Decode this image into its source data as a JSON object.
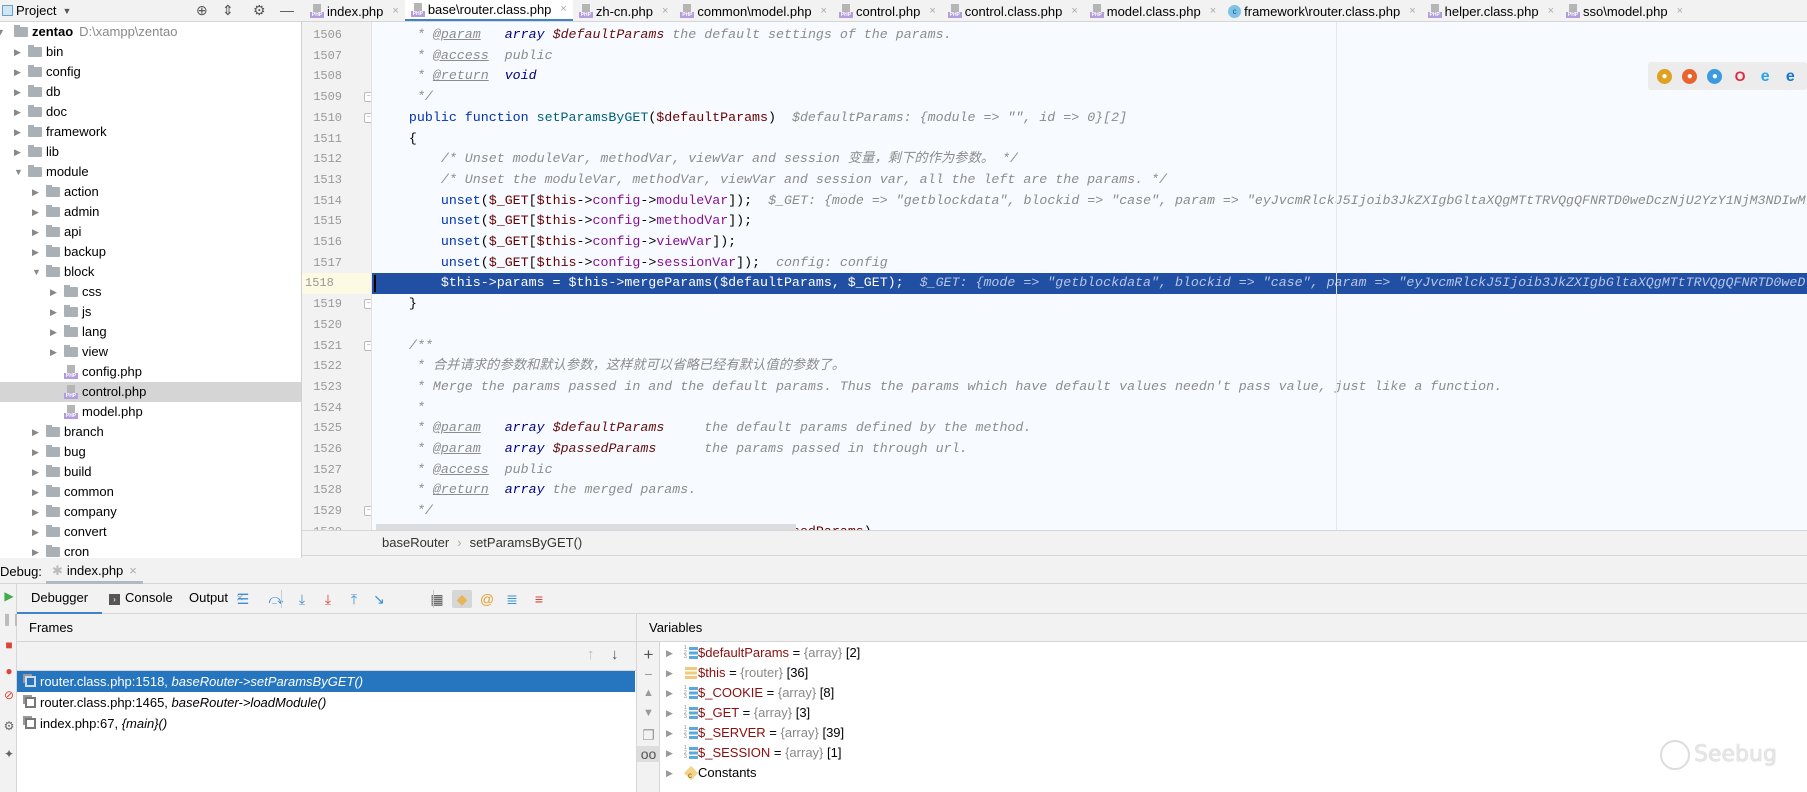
{
  "project": {
    "title": "Project",
    "toolbar_icons": [
      "locate-icon",
      "collapse-icon",
      "gear-icon",
      "minimize-icon"
    ],
    "tree": [
      {
        "label": "zentao",
        "path": "D:\\xampp\\zentao",
        "depth": 0,
        "type": "folder",
        "expanded": true,
        "root": true
      },
      {
        "label": "bin",
        "depth": 1,
        "type": "folder",
        "expanded": false
      },
      {
        "label": "config",
        "depth": 1,
        "type": "folder",
        "expanded": false
      },
      {
        "label": "db",
        "depth": 1,
        "type": "folder",
        "expanded": false
      },
      {
        "label": "doc",
        "depth": 1,
        "type": "folder",
        "expanded": false
      },
      {
        "label": "framework",
        "depth": 1,
        "type": "folder",
        "expanded": false
      },
      {
        "label": "lib",
        "depth": 1,
        "type": "folder",
        "expanded": false
      },
      {
        "label": "module",
        "depth": 1,
        "type": "folder",
        "expanded": true
      },
      {
        "label": "action",
        "depth": 2,
        "type": "folder",
        "expanded": false
      },
      {
        "label": "admin",
        "depth": 2,
        "type": "folder",
        "expanded": false
      },
      {
        "label": "api",
        "depth": 2,
        "type": "folder",
        "expanded": false
      },
      {
        "label": "backup",
        "depth": 2,
        "type": "folder",
        "expanded": false
      },
      {
        "label": "block",
        "depth": 2,
        "type": "folder",
        "expanded": true
      },
      {
        "label": "css",
        "depth": 3,
        "type": "folder",
        "expanded": false
      },
      {
        "label": "js",
        "depth": 3,
        "type": "folder",
        "expanded": false
      },
      {
        "label": "lang",
        "depth": 3,
        "type": "folder",
        "expanded": false
      },
      {
        "label": "view",
        "depth": 3,
        "type": "folder",
        "expanded": false
      },
      {
        "label": "config.php",
        "depth": 3,
        "type": "php"
      },
      {
        "label": "control.php",
        "depth": 3,
        "type": "php",
        "selected": true
      },
      {
        "label": "model.php",
        "depth": 3,
        "type": "php"
      },
      {
        "label": "branch",
        "depth": 2,
        "type": "folder",
        "expanded": false
      },
      {
        "label": "bug",
        "depth": 2,
        "type": "folder",
        "expanded": false
      },
      {
        "label": "build",
        "depth": 2,
        "type": "folder",
        "expanded": false
      },
      {
        "label": "common",
        "depth": 2,
        "type": "folder",
        "expanded": false
      },
      {
        "label": "company",
        "depth": 2,
        "type": "folder",
        "expanded": false
      },
      {
        "label": "convert",
        "depth": 2,
        "type": "folder",
        "expanded": false
      },
      {
        "label": "cron",
        "depth": 2,
        "type": "folder",
        "expanded": false
      }
    ]
  },
  "tabs": [
    {
      "label": "index.php",
      "icon": "php"
    },
    {
      "label": "base\\router.class.php",
      "icon": "php",
      "active": true
    },
    {
      "label": "zh-cn.php",
      "icon": "php"
    },
    {
      "label": "common\\model.php",
      "icon": "php"
    },
    {
      "label": "control.php",
      "icon": "php"
    },
    {
      "label": "control.class.php",
      "icon": "php"
    },
    {
      "label": "model.class.php",
      "icon": "php"
    },
    {
      "label": "framework\\router.class.php",
      "icon": "class"
    },
    {
      "label": "helper.class.php",
      "icon": "php"
    },
    {
      "label": "sso\\model.php",
      "icon": "php"
    }
  ],
  "tab_close": "×",
  "php_badge": "PHP",
  "class_badge": "c",
  "browsers": [
    {
      "name": "chrome-icon",
      "color": "#e0a020",
      "glyph": "●"
    },
    {
      "name": "firefox-icon",
      "color": "#e8642c",
      "glyph": "●"
    },
    {
      "name": "safari-icon",
      "color": "#3a9be0",
      "glyph": "●"
    },
    {
      "name": "opera-icon",
      "color": "#e0283c",
      "glyph": "O"
    },
    {
      "name": "ie-icon",
      "color": "#2aa4e6",
      "glyph": "e"
    },
    {
      "name": "edge-icon",
      "color": "#1478d4",
      "glyph": "e"
    }
  ],
  "editor": {
    "current_line": "1518",
    "lines": [
      {
        "num": "1506",
        "tokens": [
          [
            "c",
            "     * "
          ],
          [
            "tag",
            "@param"
          ],
          [
            "c",
            "   "
          ],
          [
            "type",
            "array"
          ],
          [
            "c",
            " "
          ],
          [
            "dv",
            "$defaultParams"
          ],
          [
            "c",
            " the default settings of the params."
          ]
        ]
      },
      {
        "num": "1507",
        "tokens": [
          [
            "c",
            "     * "
          ],
          [
            "tag",
            "@access"
          ],
          [
            "c",
            "  public"
          ]
        ]
      },
      {
        "num": "1508",
        "tokens": [
          [
            "c",
            "     * "
          ],
          [
            "tag",
            "@return"
          ],
          [
            "c",
            "  "
          ],
          [
            "type",
            "void"
          ]
        ]
      },
      {
        "num": "1509",
        "fold": true,
        "tokens": [
          [
            "c",
            "     */"
          ]
        ]
      },
      {
        "num": "1510",
        "fold": true,
        "tokens": [
          [
            "p",
            "    "
          ],
          [
            "kw",
            "public function "
          ],
          [
            "fn",
            "setParamsByGET"
          ],
          [
            "p",
            "("
          ],
          [
            "var",
            "$defaultParams"
          ],
          [
            "p",
            ")"
          ],
          [
            "h",
            "  $defaultParams: {module => \"\", id => 0}[2]"
          ]
        ]
      },
      {
        "num": "1511",
        "tokens": [
          [
            "p",
            "    {"
          ]
        ]
      },
      {
        "num": "1512",
        "tokens": [
          [
            "p",
            "        "
          ],
          [
            "c",
            "/* Unset moduleVar, methodVar, viewVar and session 变量，剩下的作为参数。 */"
          ]
        ]
      },
      {
        "num": "1513",
        "tokens": [
          [
            "p",
            "        "
          ],
          [
            "c",
            "/* Unset the moduleVar, methodVar, viewVar and session var, all the left are the params. */"
          ]
        ]
      },
      {
        "num": "1514",
        "tokens": [
          [
            "p",
            "        "
          ],
          [
            "kw",
            "unset"
          ],
          [
            "p",
            "("
          ],
          [
            "var",
            "$_GET"
          ],
          [
            "p",
            "["
          ],
          [
            "var",
            "$this"
          ],
          [
            "p",
            "->"
          ],
          [
            "fld",
            "config"
          ],
          [
            "p",
            "->"
          ],
          [
            "fld",
            "moduleVar"
          ],
          [
            "p",
            "]);"
          ],
          [
            "h",
            "  $_GET: {mode => \"getblockdata\", blockid => \"case\", param => \"eyJvcmRlckJ5Ijoib3JkZXIgbGltaXQgMTtTRVQgQFNRTD0weDczNjU2YzY1NjM3NDIwM"
          ]
        ]
      },
      {
        "num": "1515",
        "tokens": [
          [
            "p",
            "        "
          ],
          [
            "kw",
            "unset"
          ],
          [
            "p",
            "("
          ],
          [
            "var",
            "$_GET"
          ],
          [
            "p",
            "["
          ],
          [
            "var",
            "$this"
          ],
          [
            "p",
            "->"
          ],
          [
            "fld",
            "config"
          ],
          [
            "p",
            "->"
          ],
          [
            "fld",
            "methodVar"
          ],
          [
            "p",
            "]);"
          ]
        ]
      },
      {
        "num": "1516",
        "tokens": [
          [
            "p",
            "        "
          ],
          [
            "kw",
            "unset"
          ],
          [
            "p",
            "("
          ],
          [
            "var",
            "$_GET"
          ],
          [
            "p",
            "["
          ],
          [
            "var",
            "$this"
          ],
          [
            "p",
            "->"
          ],
          [
            "fld",
            "config"
          ],
          [
            "p",
            "->"
          ],
          [
            "fld",
            "viewVar"
          ],
          [
            "p",
            "]);"
          ]
        ]
      },
      {
        "num": "1517",
        "tokens": [
          [
            "p",
            "        "
          ],
          [
            "kw",
            "unset"
          ],
          [
            "p",
            "("
          ],
          [
            "var",
            "$_GET"
          ],
          [
            "p",
            "["
          ],
          [
            "var",
            "$this"
          ],
          [
            "p",
            "->"
          ],
          [
            "fld",
            "config"
          ],
          [
            "p",
            "->"
          ],
          [
            "fld",
            "sessionVar"
          ],
          [
            "p",
            "]);"
          ],
          [
            "h",
            "  config: config"
          ]
        ]
      },
      {
        "num": "1518",
        "highlight": true,
        "tokens": [
          [
            "p",
            "        $this->params = $this->mergeParams($defaultParams, $_GET);"
          ],
          [
            "h",
            "  $_GET: {mode => \"getblockdata\", blockid => \"case\", param => \"eyJvcmRlckJ5Ijoib3JkZXIgbGltaXQgMTtTRVQgQFNRTD0weD"
          ]
        ]
      },
      {
        "num": "1519",
        "fold": true,
        "tokens": [
          [
            "p",
            "    }"
          ]
        ]
      },
      {
        "num": "1520",
        "tokens": []
      },
      {
        "num": "1521",
        "fold": true,
        "tokens": [
          [
            "c",
            "    /**"
          ]
        ]
      },
      {
        "num": "1522",
        "tokens": [
          [
            "c",
            "     * 合并请求的参数和默认参数，这样就可以省略已经有默认值的参数了。"
          ]
        ]
      },
      {
        "num": "1523",
        "tokens": [
          [
            "c",
            "     * Merge the params passed in and the default params. Thus the params which have default values needn't pass value, just like a function."
          ]
        ]
      },
      {
        "num": "1524",
        "tokens": [
          [
            "c",
            "     *"
          ]
        ]
      },
      {
        "num": "1525",
        "tokens": [
          [
            "c",
            "     * "
          ],
          [
            "tag",
            "@param"
          ],
          [
            "c",
            "   "
          ],
          [
            "type",
            "array"
          ],
          [
            "c",
            " "
          ],
          [
            "dv",
            "$defaultParams"
          ],
          [
            "c",
            "     the default params defined by the method."
          ]
        ]
      },
      {
        "num": "1526",
        "tokens": [
          [
            "c",
            "     * "
          ],
          [
            "tag",
            "@param"
          ],
          [
            "c",
            "   "
          ],
          [
            "type",
            "array"
          ],
          [
            "c",
            " "
          ],
          [
            "dv",
            "$passedParams"
          ],
          [
            "c",
            "      the params passed in through url."
          ]
        ]
      },
      {
        "num": "1527",
        "tokens": [
          [
            "c",
            "     * "
          ],
          [
            "tag",
            "@access"
          ],
          [
            "c",
            "  public"
          ]
        ]
      },
      {
        "num": "1528",
        "tokens": [
          [
            "c",
            "     * "
          ],
          [
            "tag",
            "@return"
          ],
          [
            "c",
            "  "
          ],
          [
            "type",
            "array"
          ],
          [
            "c",
            " the merged params."
          ]
        ]
      },
      {
        "num": "1529",
        "fold": true,
        "tokens": [
          [
            "c",
            "     */"
          ]
        ]
      },
      {
        "num": "1530",
        "tokens": [
          [
            "p",
            "    "
          ],
          [
            "kw",
            "public function "
          ],
          [
            "fn",
            "mergeParams"
          ],
          [
            "p",
            "("
          ],
          [
            "var",
            "$defaultParams"
          ],
          [
            "p",
            ", "
          ],
          [
            "var",
            "$passedParams"
          ],
          [
            "p",
            ")"
          ]
        ]
      }
    ]
  },
  "breadcrumb": {
    "class": "baseRouter",
    "method": "setParamsByGET()",
    "sep": "›"
  },
  "debug": {
    "label": "Debug:",
    "session_tab": "index.php",
    "tabs": {
      "debugger": "Debugger",
      "console": "Console",
      "output": "Output",
      "close": "×"
    },
    "toolbar": [
      {
        "name": "show-execution-point-icon",
        "glyph": "☰",
        "color": "#3a8fd6"
      },
      {
        "name": "step-over-icon",
        "glyph": "⤼",
        "color": "#3a8fd6"
      },
      {
        "name": "step-into-icon",
        "glyph": "⤓",
        "color": "#3a8fd6"
      },
      {
        "name": "force-step-into-icon",
        "glyph": "⤓",
        "color": "#d9453a"
      },
      {
        "name": "step-out-icon",
        "glyph": "⤒",
        "color": "#3a8fd6"
      },
      {
        "name": "run-to-cursor-icon",
        "glyph": "↘",
        "color": "#3a8fd6"
      },
      {
        "name": "evaluate-expression-icon",
        "glyph": "▦",
        "color": "#555"
      },
      {
        "name": "show-constants-icon",
        "glyph": "◆",
        "color": "#e6b45a",
        "on": true
      },
      {
        "name": "show-watches-icon",
        "glyph": "@",
        "color": "#e6a030"
      },
      {
        "name": "list-icon",
        "glyph": "≣",
        "color": "#3a8fd6"
      },
      {
        "name": "add-to-watches-icon",
        "glyph": "≡",
        "color": "#d9453a"
      }
    ],
    "frames_title": "Frames",
    "frames": [
      {
        "loc": "router.class.php:1518, ",
        "fn": "baseRouter->setParamsByGET()",
        "selected": true
      },
      {
        "loc": "router.class.php:1465, ",
        "fn": "baseRouter->loadModule()"
      },
      {
        "loc": "index.php:67, ",
        "fn": "{main}()"
      }
    ],
    "variables_title": "Variables",
    "variables": [
      {
        "name": "$defaultParams",
        "type": "{array}",
        "count": "[2]",
        "icon": "array"
      },
      {
        "name": "$this",
        "type": "{router}",
        "count": "[36]",
        "icon": "object"
      },
      {
        "name": "$_COOKIE",
        "type": "{array}",
        "count": "[8]",
        "icon": "array"
      },
      {
        "name": "$_GET",
        "type": "{array}",
        "count": "[3]",
        "icon": "array"
      },
      {
        "name": "$_SERVER",
        "type": "{array}",
        "count": "[39]",
        "icon": "array"
      },
      {
        "name": "$_SESSION",
        "type": "{array}",
        "count": "[1]",
        "icon": "array"
      },
      {
        "name": "Constants",
        "icon": "constants"
      }
    ]
  },
  "watermark": "Seebug",
  "colors": {
    "accent": "#4083c9",
    "exec_line": "#214fa3",
    "frame_selected": "#2675bf"
  }
}
